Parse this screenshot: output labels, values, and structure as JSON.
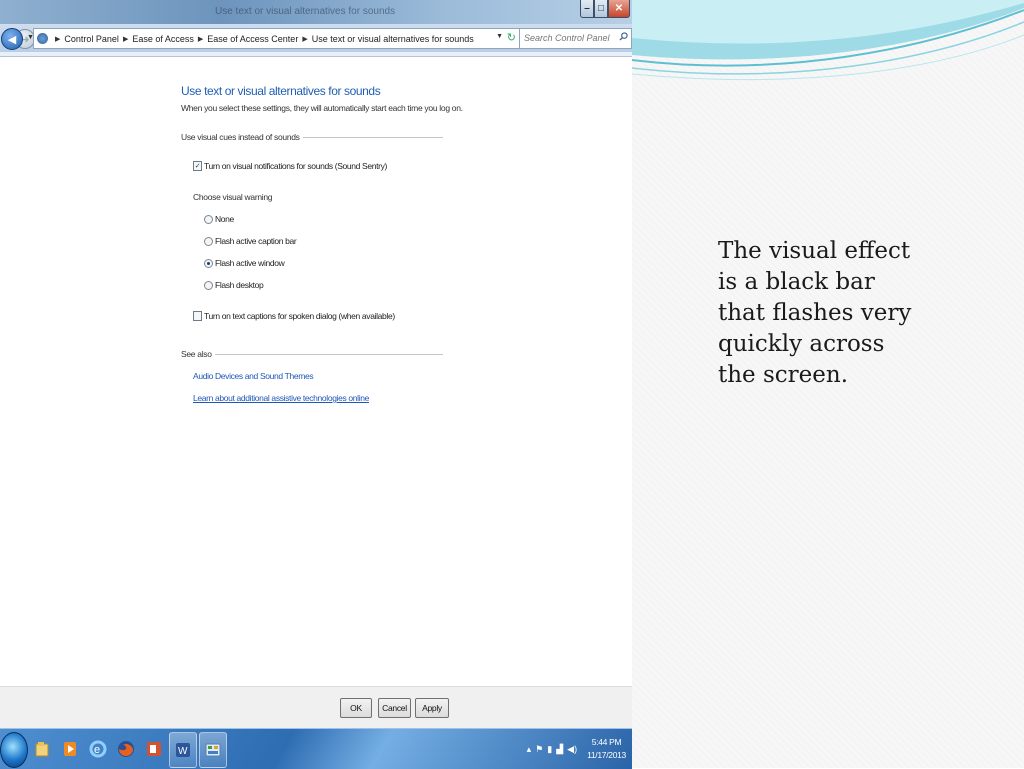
{
  "window": {
    "title": "Use text or visual alternatives for sounds",
    "address_crumbs": [
      "Control Panel",
      "Ease of Access",
      "Ease of Access Center",
      "Use text or visual alternatives for sounds"
    ],
    "search_placeholder": "Search Control Panel"
  },
  "main": {
    "title": "Use text or visual alternatives for sounds",
    "description": "When you select these settings, they will automatically start each time you log on.",
    "group_visual": "Use visual cues instead of sounds",
    "sound_sentry_label": "Turn on visual notifications for sounds (Sound Sentry)",
    "sound_sentry_checked": true,
    "choose_label": "Choose visual warning",
    "radios": [
      {
        "label": "None",
        "selected": false
      },
      {
        "label": "Flash active caption bar",
        "selected": false
      },
      {
        "label": "Flash active window",
        "selected": true
      },
      {
        "label": "Flash desktop",
        "selected": false
      }
    ],
    "captions_label": "Turn on text captions for spoken dialog (when available)",
    "captions_checked": false,
    "see_also": "See also",
    "links": [
      "Audio Devices and Sound Themes",
      "Learn about additional assistive technologies online"
    ]
  },
  "buttons": {
    "ok": "OK",
    "cancel": "Cancel",
    "apply": "Apply"
  },
  "taskbar": {
    "time": "5:44 PM",
    "date": "11/17/2013",
    "apps": [
      "windows-explorer-icon",
      "media-player-icon",
      "internet-explorer-icon",
      "firefox-icon",
      "powerpoint-icon",
      "word-icon",
      "control-panel-icon"
    ]
  },
  "slide": {
    "text": "The visual effect is a black bar that flashes very quickly across the screen."
  },
  "colors": {
    "link": "#1f57b8",
    "title": "#1e5fb3",
    "taskbar": "#2f6db3",
    "close_button": "#c7452b"
  }
}
